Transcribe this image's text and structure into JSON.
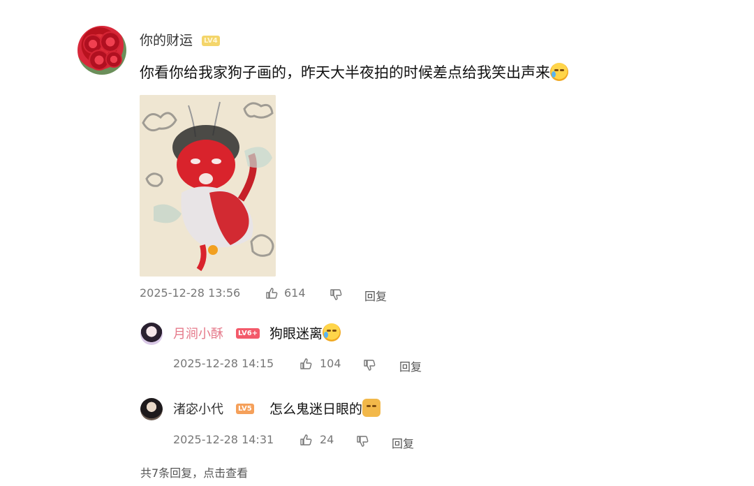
{
  "main_comment": {
    "username": "你的财运",
    "level": "LV4",
    "text": "你看你给我家狗子画的，昨天大半夜拍的时候差点给我笑出声来",
    "emoji": "laughing-crying-emoji",
    "timestamp": "2025-12-28 13:56",
    "likes": "614",
    "reply_label": "回复"
  },
  "replies": [
    {
      "username": "月涧小酥",
      "level": "LV6+",
      "text": "狗眼迷离",
      "emoji": "laughing-crying-emoji",
      "timestamp": "2025-12-28 14:15",
      "likes": "104",
      "reply_label": "回复"
    },
    {
      "username": "渚宓小代",
      "level": "LV5",
      "text": "怎么鬼迷日眼的",
      "emoji": "dog-face-emoji",
      "timestamp": "2025-12-28 14:31",
      "likes": "24",
      "reply_label": "回复"
    }
  ],
  "more_replies": "共7条回复，点击查看",
  "colors": {
    "accent_pink": "#e5798a",
    "meta_gray": "#777777",
    "badge_gold": "#f4d56a"
  }
}
